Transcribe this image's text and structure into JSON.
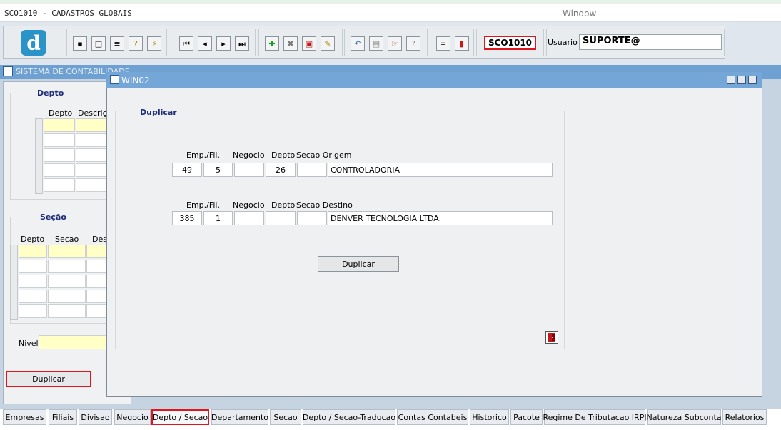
{
  "app": {
    "title": "SCO1010 - CADASTROS GLOBAIS",
    "menu_window": "Window"
  },
  "toolbar": {
    "form_code": "SCO1010",
    "user_label": "Usuario",
    "user_value": "SUPORTE@",
    "logo": "d"
  },
  "main_window": {
    "title": "SISTEMA DE CONTABILIDADE"
  },
  "left_panel": {
    "depto_frame": "Depto",
    "depto_cols": [
      "Depto",
      "Descriçã"
    ],
    "secao_frame": "Seção",
    "secao_cols": [
      "Depto",
      "Secao",
      "Des"
    ],
    "nivel_label": "Nivel",
    "duplicar_button": "Duplicar"
  },
  "win02": {
    "title": "WIN02",
    "frame_label": "Duplicar",
    "origem": {
      "labels": {
        "emp": "Emp./Fil.",
        "negocio": "Negocio",
        "depto": "Depto",
        "secao": "Secao Origem"
      },
      "emp": "49",
      "fil": "5",
      "negocio": "",
      "depto": "26",
      "secao": "",
      "descricao": "CONTROLADORIA"
    },
    "destino": {
      "labels": {
        "emp": "Emp./Fil.",
        "negocio": "Negocio",
        "depto": "Depto",
        "secao": "Secao Destino"
      },
      "emp": "385",
      "fil": "1",
      "negocio": "",
      "depto": "",
      "secao": "",
      "descricao": "DENVER TECNOLOGIA LTDA."
    },
    "duplicar_button": "Duplicar"
  },
  "tabs": [
    {
      "label": "Empresas"
    },
    {
      "label": "Filiais"
    },
    {
      "label": "Divisao"
    },
    {
      "label": "Negocio"
    },
    {
      "label": "Depto / Secao",
      "active": true
    },
    {
      "label": "Departamento"
    },
    {
      "label": "Secao"
    },
    {
      "label": "Depto / Secao-Traducao"
    },
    {
      "label": "Contas Contabeis"
    },
    {
      "label": "Historico"
    },
    {
      "label": "Pacote"
    },
    {
      "label": "Regime De Tributacao IRPJ"
    },
    {
      "label": "Natureza Subconta"
    },
    {
      "label": "Relatorios"
    }
  ],
  "colors": {
    "accent_red": "#e0141e",
    "title_blue": "#74a6d8",
    "field_yellow": "#ffffc6",
    "label_navy": "#1c2a78"
  }
}
